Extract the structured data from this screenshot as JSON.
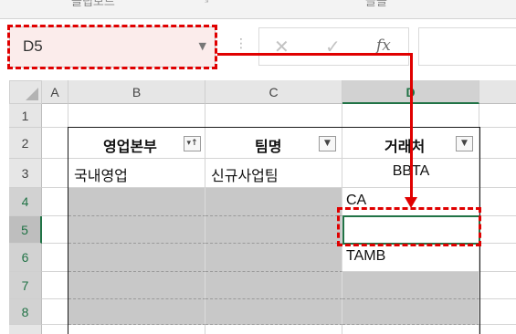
{
  "name_box": {
    "value": "D5"
  },
  "formula_bar": {
    "cancel_symbol": "✕",
    "enter_symbol": "✓",
    "fx_symbol": "fx",
    "formula_value": ""
  },
  "ribbon": {
    "group_labels": [
      "클립보드",
      "글꼴"
    ]
  },
  "columns": [
    "A",
    "B",
    "C",
    "D"
  ],
  "rows": [
    "1",
    "2",
    "3",
    "4",
    "5",
    "6",
    "7",
    "8"
  ],
  "table": {
    "headers": [
      "영업본부",
      "팀명",
      "거래처"
    ],
    "filter_icons": [
      "sorted-filter-icon",
      "filter-dropdown-icon",
      "filter-dropdown-icon"
    ],
    "cells": {
      "B3": "국내영업",
      "C3": "신규사업팀",
      "D3": "BBTA",
      "D4": "CA",
      "D5": "",
      "D6": "TAMB"
    }
  },
  "colors": {
    "highlight": "#e00000",
    "excel_green": "#217346",
    "shaded_cell": "#c8c8c8"
  }
}
